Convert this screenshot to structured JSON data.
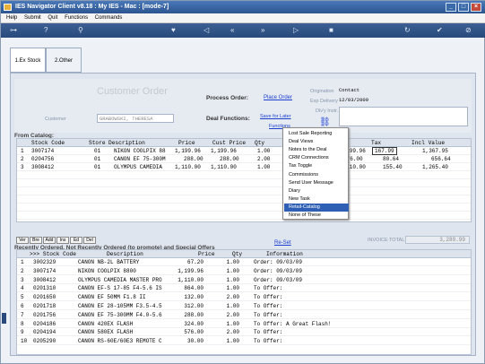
{
  "window": {
    "title": "IES Navigator Client v8.18 : My IES - Mac : [mode-7]"
  },
  "menubar": [
    "Help",
    "Submit",
    "Quit",
    "Functions",
    "Commands"
  ],
  "tabs": [
    {
      "label": "1.Ex Stock"
    },
    {
      "label": "2.Other"
    }
  ],
  "form": {
    "heading": "Customer Order",
    "process_label": "Process Order:",
    "place_order": "Place Order",
    "customer_label": "Customer",
    "customer_value": "GRABOWSKI, THERESA",
    "deal_label": "Deal Functions:",
    "save_later": "Save for Later",
    "functions": "Functions",
    "origination_label": "Origination",
    "origination_value": "Contact",
    "exp_delivery_label": "Exp Delivery",
    "exp_delivery_value": "12/03/2009",
    "dlv_instr_label": "Dlv'y Instr."
  },
  "catalog": {
    "label": "From Catalog:",
    "headers": [
      "Stock Code",
      "Store",
      "Description",
      "Price",
      "Cust Price",
      "Qty",
      "Tax",
      "Incl Value"
    ],
    "rows": [
      {
        "n": "1",
        "code": "3007174",
        "store": "01",
        "desc": "NIKON COOLPIX 88",
        "price": "1,199.96",
        "cust": "1,199.96",
        "qty": "1.00",
        "amt": "1,199.96",
        "tax": "167.99",
        "incl": "1,367.95"
      },
      {
        "n": "2",
        "code": "0204756",
        "store": "01",
        "desc": "CANON EF 75-300M",
        "price": "288.00",
        "cust": "288.00",
        "qty": "2.00",
        "amt": "576.00",
        "tax": "80.64",
        "incl": "656.64"
      },
      {
        "n": "3",
        "code": "3008412",
        "store": "01",
        "desc": "OLYMPUS CAMEDIA",
        "price": "1,110.00",
        "cust": "1,110.00",
        "qty": "1.00",
        "amt": "1,110.00",
        "tax": "155.40",
        "incl": "1,265.40"
      }
    ],
    "buttons": [
      "Ver",
      "Bre",
      "Add",
      "Ins",
      "Ed",
      "Del"
    ],
    "invoice_total_label": "INVOICE TOTAL",
    "invoice_total_value": "3,289.99"
  },
  "recent": {
    "label": "Recently Ordered, Not Recently Ordered (to promote) and Special Offers",
    "reset": "Re-Set",
    "headers": [
      ">>> Stock Code",
      "Description",
      "Price",
      "Qty",
      "Information"
    ],
    "rows": [
      {
        "n": "1",
        "code": "3002329",
        "desc": "CANON NB-2L BATTERY",
        "price": "67.20",
        "qty": "1.00",
        "info": "Order: 09/03/09"
      },
      {
        "n": "2",
        "code": "3007174",
        "desc": "NIKON COOLPIX 8800",
        "price": "1,199.96",
        "qty": "1.00",
        "info": "Order: 09/03/09"
      },
      {
        "n": "3",
        "code": "3008412",
        "desc": "OLYMPUS CAMEDIA MASTER PRO",
        "price": "1,110.00",
        "qty": "1.00",
        "info": "Order: 09/03/09"
      },
      {
        "n": "4",
        "code": "0201310",
        "desc": "CANON EF-S 17-85 F4-5.6 IS",
        "price": "864.00",
        "qty": "1.00",
        "info": "To Offer:"
      },
      {
        "n": "5",
        "code": "0201650",
        "desc": "CANON EF 50MM F1.8 II",
        "price": "132.00",
        "qty": "2.00",
        "info": "To Offer:"
      },
      {
        "n": "6",
        "code": "0201718",
        "desc": "CANON EF 28-105MM F3.5-4.5",
        "price": "312.00",
        "qty": "1.00",
        "info": "To Offer:"
      },
      {
        "n": "7",
        "code": "0201756",
        "desc": "CANON EF 75-300MM F4.0-5.6",
        "price": "288.00",
        "qty": "2.00",
        "info": "To Offer:"
      },
      {
        "n": "8",
        "code": "0204186",
        "desc": "CANON 420EX FLASH",
        "price": "324.00",
        "qty": "1.00",
        "info": "To Offer: A Great Flash!"
      },
      {
        "n": "9",
        "code": "0204194",
        "desc": "CANON 580EX FLASH",
        "price": "576.00",
        "qty": "2.00",
        "info": "To Offer:"
      },
      {
        "n": "10",
        "code": "0205290",
        "desc": "CANON RS-60E/60E3 REMOTE C",
        "price": "30.00",
        "qty": "1.00",
        "info": "To Offer:"
      }
    ]
  },
  "context_menu": {
    "items": [
      "Lost Sale Reporting",
      "Deal Views",
      "Notes to the Deal",
      "CRM Connections",
      "Tax Toggle",
      "Commissions",
      "Send User Message",
      "Diary",
      "New Task",
      "Retail-Catalog",
      "None of These"
    ],
    "selected": "Retail-Catalog"
  },
  "colors": {
    "accent": "#2f5fb5",
    "title": "#c9ccd4",
    "link": "#1c3fd0"
  }
}
